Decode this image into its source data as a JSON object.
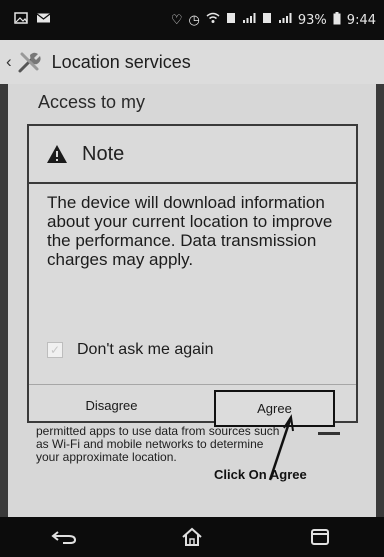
{
  "status_bar": {
    "battery": "93%",
    "time": "9:44",
    "icons": [
      "image-icon",
      "mail-icon",
      "heart-icon",
      "clock-icon",
      "wifi-icon",
      "signal-icon",
      "signal-icon"
    ]
  },
  "action_bar": {
    "title": "Location services",
    "back_icon": "chevron-left-icon",
    "app_icon": "tools-icon"
  },
  "background": {
    "heading": "Access to my",
    "description": "permitted apps to use data from sources such as Wi-Fi and mobile networks to determine your approximate location."
  },
  "dialog": {
    "title": "Note",
    "title_icon": "warning-icon",
    "message": "The device will download information about your current location to improve the performance. Data transmission charges may apply.",
    "checkbox_label": "Don't ask me again",
    "checkbox_checked": true,
    "disagree_label": "Disagree",
    "agree_label": "Agree"
  },
  "annotation": {
    "text": "Click On Agree"
  },
  "nav_bar": {
    "buttons": [
      "back-icon",
      "home-icon",
      "recents-icon"
    ]
  },
  "colors": {
    "dialog_bg": "#dadada",
    "bar_bg": "#0d0d0d",
    "border": "#3a3a3a"
  }
}
